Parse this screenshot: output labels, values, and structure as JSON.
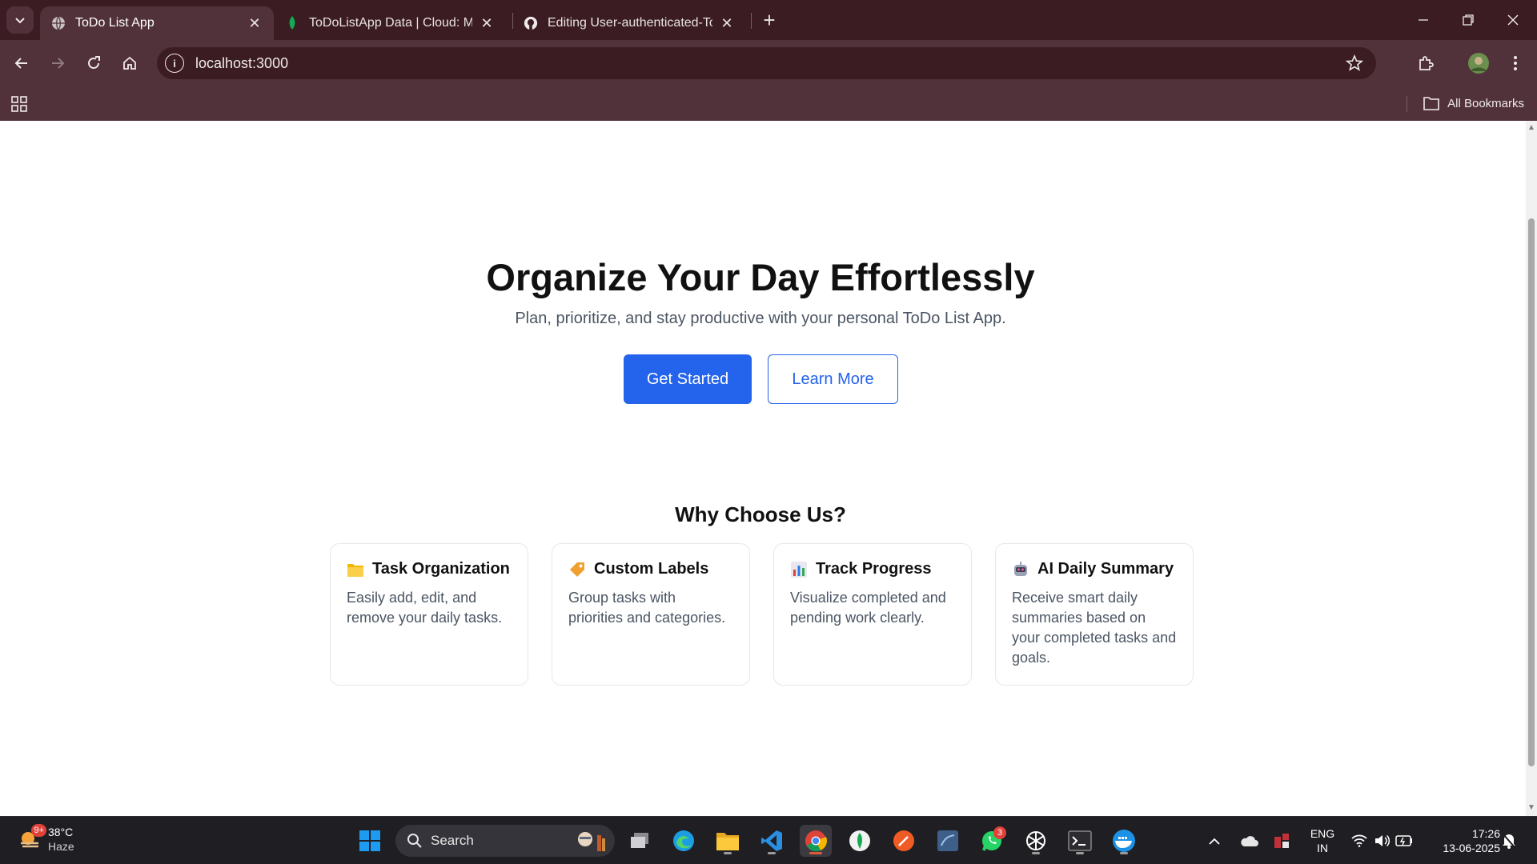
{
  "browser": {
    "tabs": [
      {
        "title": "ToDo List App",
        "favicon": "globe-icon",
        "active": true
      },
      {
        "title": "ToDoListApp Data | Cloud: Mon",
        "favicon": "mongodb-leaf-icon",
        "active": false
      },
      {
        "title": "Editing User-authenticated-To-",
        "favicon": "github-icon",
        "active": false
      }
    ],
    "url": "localhost:3000",
    "all_bookmarks_label": "All Bookmarks"
  },
  "hero": {
    "title": "Organize Your Day Effortlessly",
    "subtitle": "Plan, prioritize, and stay productive with your personal ToDo List App.",
    "primary_button": "Get Started",
    "secondary_button": "Learn More"
  },
  "features": {
    "heading": "Why Choose Us?",
    "cards": [
      {
        "icon": "folder-icon",
        "title": "Task Organization",
        "desc": "Easily add, edit, and remove your daily tasks."
      },
      {
        "icon": "label-tag-icon",
        "title": "Custom Labels",
        "desc": "Group tasks with priorities and categories."
      },
      {
        "icon": "bar-chart-icon",
        "title": "Track Progress",
        "desc": "Visualize completed and pending work clearly."
      },
      {
        "icon": "robot-icon",
        "title": "AI Daily Summary",
        "desc": "Receive smart daily summaries based on your completed tasks and goals."
      }
    ]
  },
  "taskbar": {
    "weather_badge": "9+",
    "temperature": "38°C",
    "condition": "Haze",
    "search_label": "Search",
    "whatsapp_badge": "3",
    "language": "ENG",
    "region": "IN",
    "time": "17:26",
    "date": "13-06-2025"
  }
}
